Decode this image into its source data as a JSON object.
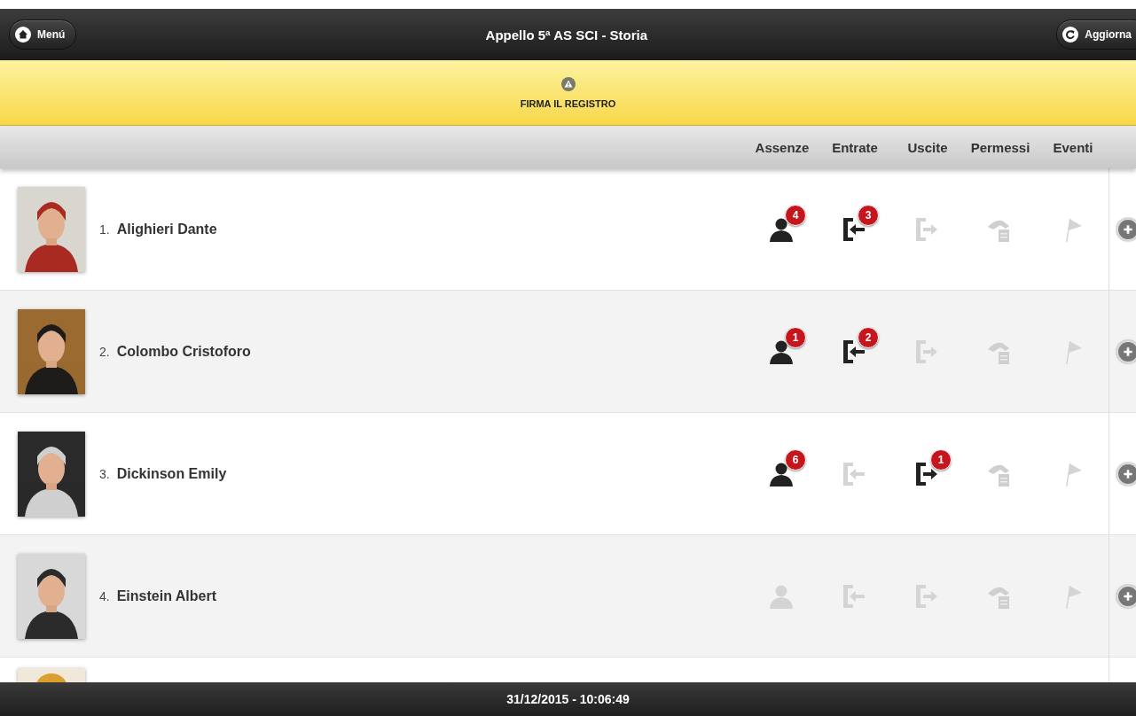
{
  "header": {
    "title": "Appello 5ª AS SCI - Storia",
    "left_button": "Menú",
    "right_button": "Aggiorna"
  },
  "banner": {
    "text": "FIRMA IL REGISTRO"
  },
  "columns": [
    "Assenze",
    "Entrate",
    "Uscite",
    "Permessi",
    "Eventi"
  ],
  "rows": [
    {
      "number": "1.",
      "name": "Alighieri Dante",
      "marks": [
        {
          "kind": "absence",
          "active": true,
          "count": "4"
        },
        {
          "kind": "entry",
          "active": true,
          "count": "3"
        },
        {
          "kind": "exit",
          "active": false
        },
        {
          "kind": "permit",
          "active": false
        },
        {
          "kind": "event",
          "active": false
        }
      ]
    },
    {
      "number": "2.",
      "name": "Colombo Cristoforo",
      "marks": [
        {
          "kind": "absence",
          "active": true,
          "count": "1"
        },
        {
          "kind": "entry",
          "active": true,
          "count": "2"
        },
        {
          "kind": "exit",
          "active": false
        },
        {
          "kind": "permit",
          "active": false
        },
        {
          "kind": "event",
          "active": false
        }
      ]
    },
    {
      "number": "3.",
      "name": "Dickinson Emily",
      "marks": [
        {
          "kind": "absence",
          "active": true,
          "count": "6"
        },
        {
          "kind": "entry",
          "active": false
        },
        {
          "kind": "exit",
          "active": true,
          "count": "1"
        },
        {
          "kind": "permit",
          "active": false
        },
        {
          "kind": "event",
          "active": false
        }
      ]
    },
    {
      "number": "4.",
      "name": "Einstein Albert",
      "marks": [
        {
          "kind": "absence",
          "active": false
        },
        {
          "kind": "entry",
          "active": false
        },
        {
          "kind": "exit",
          "active": false
        },
        {
          "kind": "permit",
          "active": false
        },
        {
          "kind": "event",
          "active": false
        }
      ]
    }
  ],
  "footer": {
    "text": "31/12/2015 - 10:06:49"
  }
}
